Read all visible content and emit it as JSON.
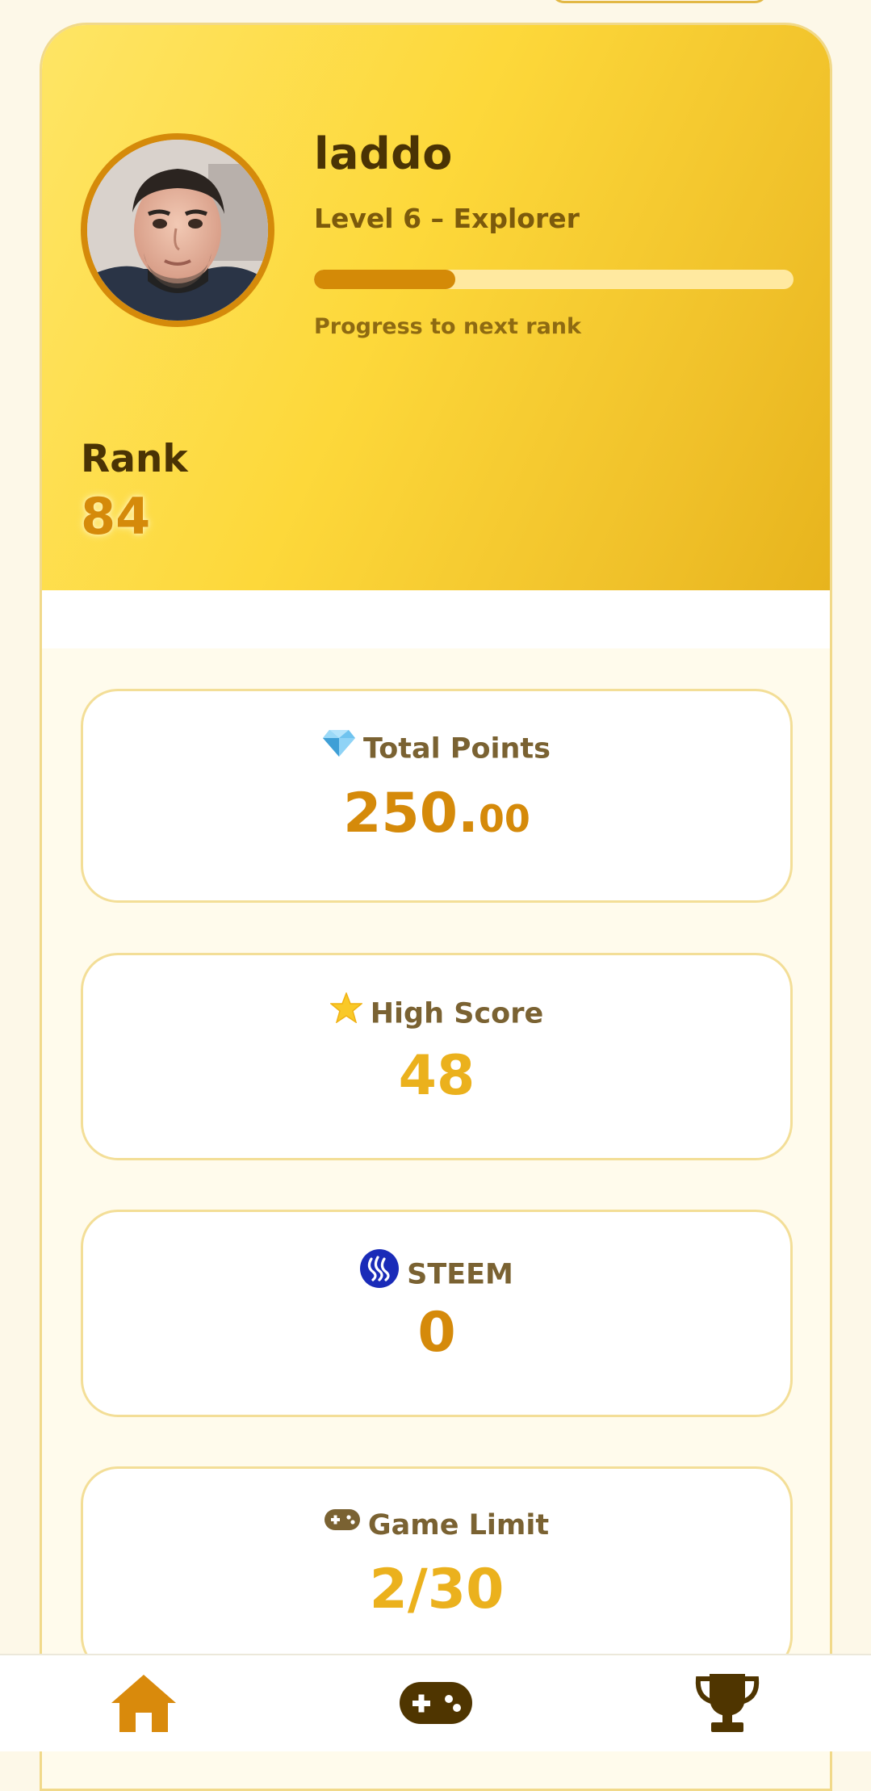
{
  "profile": {
    "username": "laddo",
    "level_text": "Level 6 – Explorer",
    "progress_fraction": 0.295,
    "progress_caption": "Progress to next rank",
    "rank_label": "Rank",
    "rank_value": "84"
  },
  "stats": {
    "total_points": {
      "label": "Total Points",
      "value_int": "250.",
      "value_dec": "00",
      "icon": "gem-icon",
      "color": "#d58a0a"
    },
    "high_score": {
      "label": "High Score",
      "value": "48",
      "icon": "star-icon",
      "color": "#ebb11d"
    },
    "steem": {
      "label": "STEEM",
      "value": "0",
      "icon": "steem-logo-icon",
      "color": "#d58a0a"
    },
    "game_limit": {
      "label": "Game Limit",
      "value": "2/30",
      "icon": "gamepad-icon",
      "color": "#ebb11d"
    }
  },
  "nav": {
    "items": [
      {
        "name": "home",
        "icon": "home-icon",
        "active": true,
        "color": "#d98a0c"
      },
      {
        "name": "games",
        "icon": "gamepad-icon",
        "active": false,
        "color": "#4f3500"
      },
      {
        "name": "leaderboard",
        "icon": "trophy-icon",
        "active": false,
        "color": "#4f3500"
      }
    ]
  },
  "colors": {
    "accent": "#d58a0a",
    "brand_yellow": "#fdd83a",
    "dark_brown": "#4a3304"
  }
}
